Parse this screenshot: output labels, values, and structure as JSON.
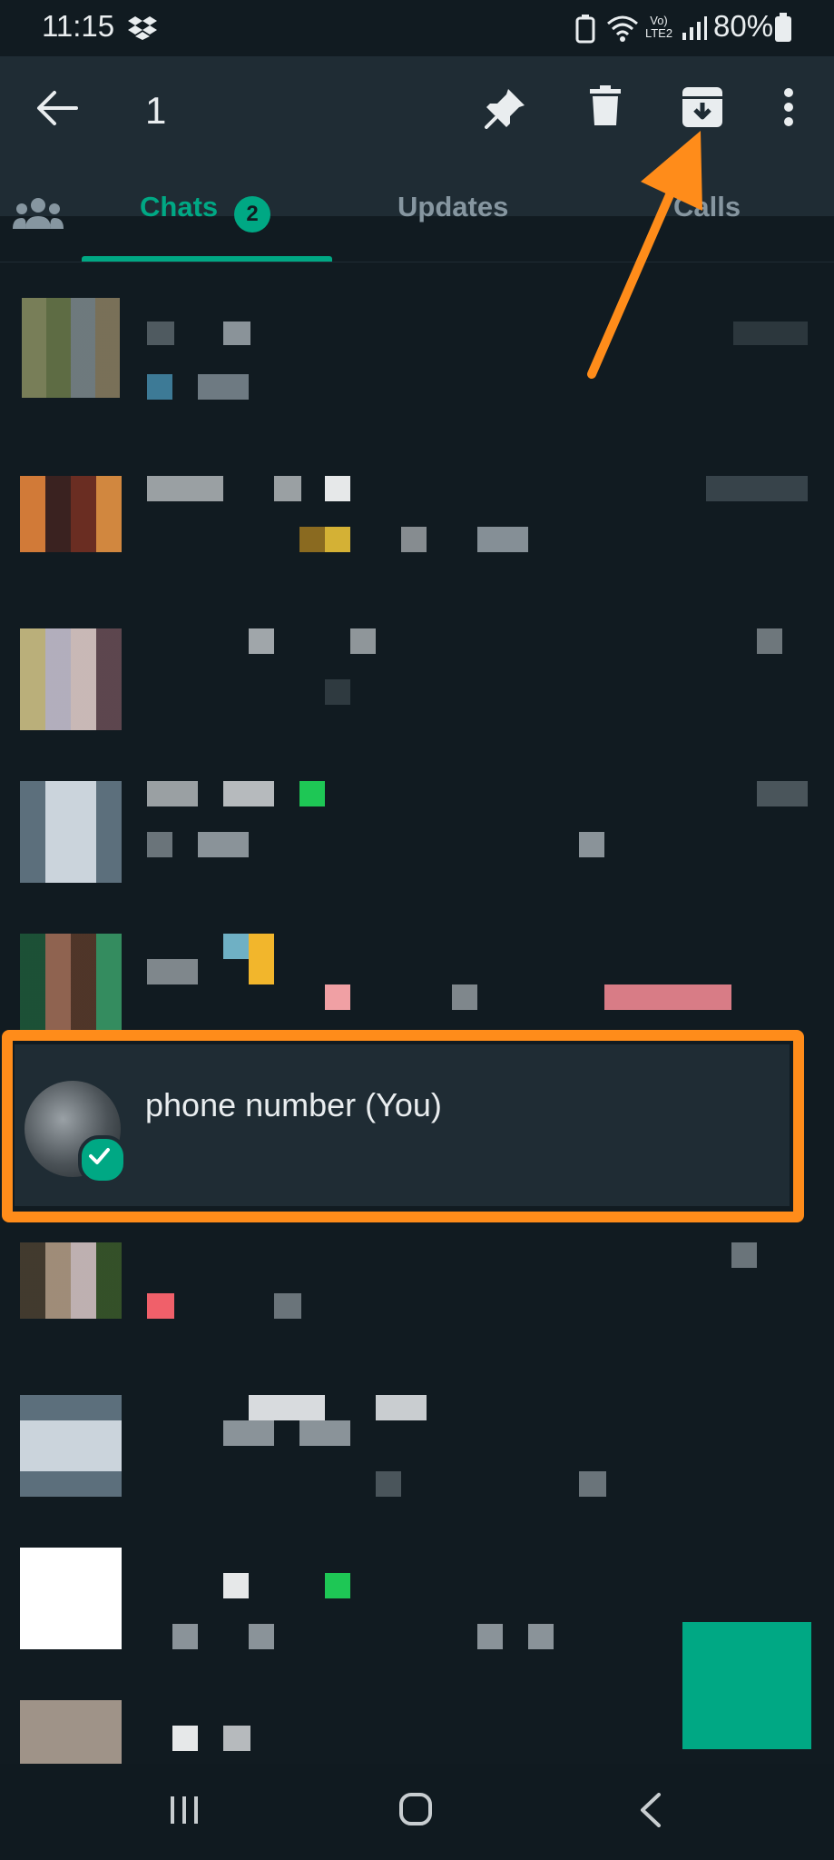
{
  "status_bar": {
    "time": "11:15",
    "battery": "80%",
    "network_label": "Vo) LTE2"
  },
  "action_bar": {
    "selected_count": "1",
    "icons": [
      "back-arrow-icon",
      "pin-icon",
      "delete-icon",
      "archive-icon",
      "more-vert-icon"
    ]
  },
  "tabs": {
    "community_icon": "community-icon",
    "items": [
      {
        "label": "Chats",
        "badge": "2",
        "active": true
      },
      {
        "label": "Updates",
        "active": false
      },
      {
        "label": "Calls",
        "active": false
      }
    ]
  },
  "selected_chat": {
    "name": "phone number (You)"
  },
  "colors": {
    "accent": "#00a884",
    "annotation": "#ff8c1a",
    "background": "#111b21",
    "header": "#1f2c34"
  }
}
